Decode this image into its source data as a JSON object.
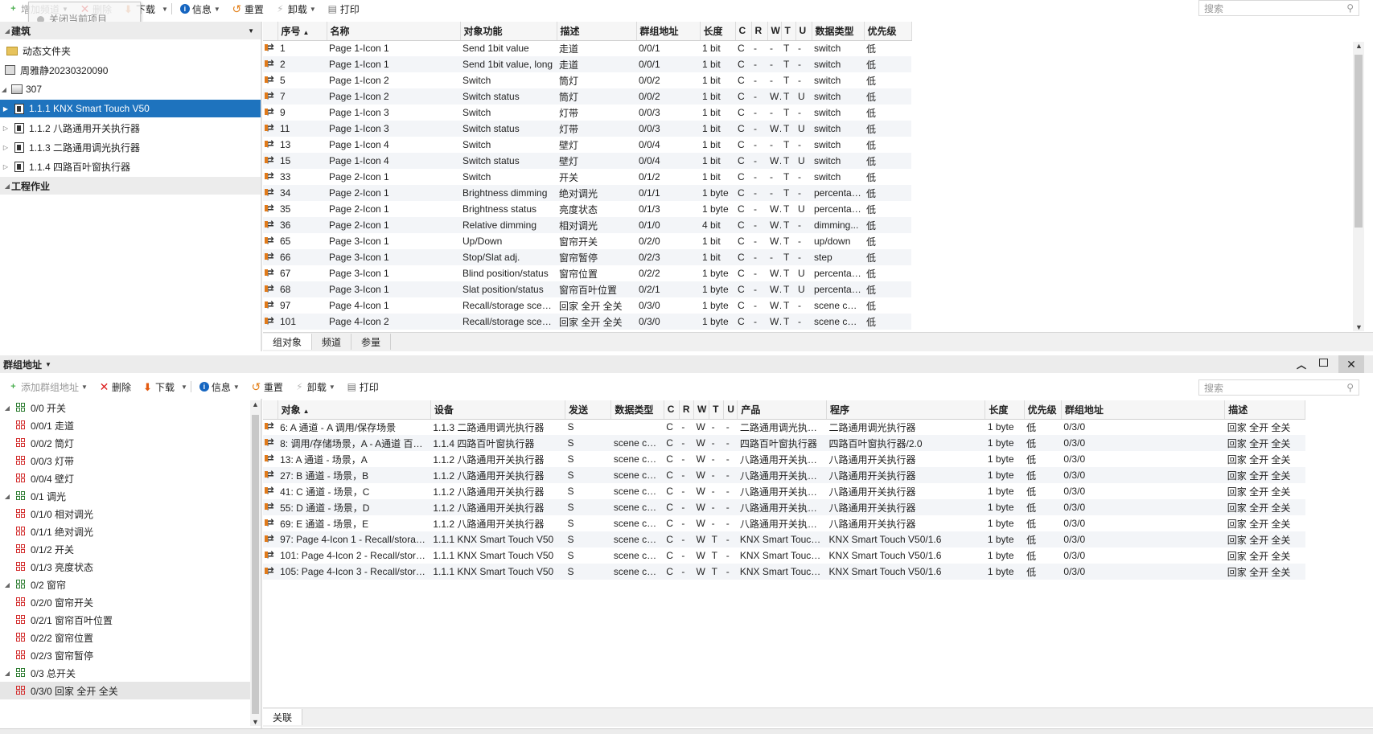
{
  "top_toolbar": {
    "add_label": "增加频道",
    "delete_label": "删除",
    "download_label": "下载",
    "info_label": "信息",
    "reset_label": "重置",
    "unload_label": "卸载",
    "print_label": "打印",
    "tooltip_text": "关闭当前项目",
    "search_placeholder": "搜索"
  },
  "building_panel": {
    "header": "建筑",
    "footer": "工程作业",
    "items": [
      {
        "label": "动态文件夹"
      },
      {
        "label": "周雅静20230320090"
      },
      {
        "label": "307"
      },
      {
        "label": "1.1.1 KNX Smart Touch V50"
      },
      {
        "label": "1.1.2 八路通用开关执行器"
      },
      {
        "label": "1.1.3 二路通用调光执行器"
      },
      {
        "label": "1.1.4 四路百叶窗执行器"
      }
    ]
  },
  "objects_table": {
    "columns": [
      "序号",
      "名称",
      "对象功能",
      "描述",
      "群组地址",
      "长度",
      "C",
      "R",
      "W",
      "T",
      "U",
      "数据类型",
      "优先级"
    ],
    "rows": [
      [
        "1",
        "Page 1-Icon 1",
        "Send 1bit value",
        "走道",
        "0/0/1",
        "1 bit",
        "C",
        "-",
        "-",
        "T",
        "-",
        "switch",
        "低"
      ],
      [
        "2",
        "Page 1-Icon 1",
        "Send 1bit value, long",
        "走道",
        "0/0/1",
        "1 bit",
        "C",
        "-",
        "-",
        "T",
        "-",
        "switch",
        "低"
      ],
      [
        "5",
        "Page 1-Icon 2",
        "Switch",
        "筒灯",
        "0/0/2",
        "1 bit",
        "C",
        "-",
        "-",
        "T",
        "-",
        "switch",
        "低"
      ],
      [
        "7",
        "Page 1-Icon 2",
        "Switch status",
        "筒灯",
        "0/0/2",
        "1 bit",
        "C",
        "-",
        "W",
        "T",
        "U",
        "switch",
        "低"
      ],
      [
        "9",
        "Page 1-Icon 3",
        "Switch",
        "灯带",
        "0/0/3",
        "1 bit",
        "C",
        "-",
        "-",
        "T",
        "-",
        "switch",
        "低"
      ],
      [
        "11",
        "Page 1-Icon 3",
        "Switch status",
        "灯带",
        "0/0/3",
        "1 bit",
        "C",
        "-",
        "W",
        "T",
        "U",
        "switch",
        "低"
      ],
      [
        "13",
        "Page 1-Icon 4",
        "Switch",
        "壁灯",
        "0/0/4",
        "1 bit",
        "C",
        "-",
        "-",
        "T",
        "-",
        "switch",
        "低"
      ],
      [
        "15",
        "Page 1-Icon 4",
        "Switch status",
        "壁灯",
        "0/0/4",
        "1 bit",
        "C",
        "-",
        "W",
        "T",
        "U",
        "switch",
        "低"
      ],
      [
        "33",
        "Page 2-Icon 1",
        "Switch",
        "开关",
        "0/1/2",
        "1 bit",
        "C",
        "-",
        "-",
        "T",
        "-",
        "switch",
        "低"
      ],
      [
        "34",
        "Page 2-Icon 1",
        "Brightness dimming",
        "绝对调光",
        "0/1/1",
        "1 byte",
        "C",
        "-",
        "-",
        "T",
        "-",
        "percentag...",
        "低"
      ],
      [
        "35",
        "Page 2-Icon 1",
        "Brightness status",
        "亮度状态",
        "0/1/3",
        "1 byte",
        "C",
        "-",
        "W",
        "T",
        "U",
        "percentag...",
        "低"
      ],
      [
        "36",
        "Page 2-Icon 1",
        "Relative dimming",
        "相对调光",
        "0/1/0",
        "4 bit",
        "C",
        "-",
        "W",
        "T",
        "-",
        "dimming...",
        "低"
      ],
      [
        "65",
        "Page 3-Icon 1",
        "Up/Down",
        "窗帘开关",
        "0/2/0",
        "1 bit",
        "C",
        "-",
        "W",
        "T",
        "-",
        "up/down",
        "低"
      ],
      [
        "66",
        "Page 3-Icon 1",
        "Stop/Slat adj.",
        "窗帘暂停",
        "0/2/3",
        "1 bit",
        "C",
        "-",
        "-",
        "T",
        "-",
        "step",
        "低"
      ],
      [
        "67",
        "Page 3-Icon 1",
        "Blind position/status",
        "窗帘位置",
        "0/2/2",
        "1 byte",
        "C",
        "-",
        "W",
        "T",
        "U",
        "percentag...",
        "低"
      ],
      [
        "68",
        "Page 3-Icon 1",
        "Slat position/status",
        "窗帘百叶位置",
        "0/2/1",
        "1 byte",
        "C",
        "-",
        "W",
        "T",
        "U",
        "percentag...",
        "低"
      ],
      [
        "97",
        "Page 4-Icon 1",
        "Recall/storage scene...",
        "回家 全开 全关",
        "0/3/0",
        "1 byte",
        "C",
        "-",
        "W",
        "T",
        "-",
        "scene con...",
        "低"
      ],
      [
        "101",
        "Page 4-Icon 2",
        "Recall/storage scene...",
        "回家 全开 全关",
        "0/3/0",
        "1 byte",
        "C",
        "-",
        "W",
        "T",
        "-",
        "scene con...",
        "低"
      ]
    ]
  },
  "objects_tabs": [
    "组对象",
    "频道",
    "参量"
  ],
  "group_panel": {
    "header": "群组地址",
    "toolbar": {
      "add_label": "添加群组地址",
      "delete_label": "删除",
      "download_label": "下载",
      "info_label": "信息",
      "reset_label": "重置",
      "unload_label": "卸载",
      "print_label": "打印",
      "search_placeholder": "搜索"
    },
    "tree": [
      {
        "label": "0/0 开关",
        "level": 0
      },
      {
        "label": "0/0/1 走道",
        "level": 1
      },
      {
        "label": "0/0/2 筒灯",
        "level": 1
      },
      {
        "label": "0/0/3 灯带",
        "level": 1
      },
      {
        "label": "0/0/4 壁灯",
        "level": 1
      },
      {
        "label": "0/1 调光",
        "level": 0
      },
      {
        "label": "0/1/0 相对调光",
        "level": 1
      },
      {
        "label": "0/1/1 绝对调光",
        "level": 1
      },
      {
        "label": "0/1/2 开关",
        "level": 1
      },
      {
        "label": "0/1/3 亮度状态",
        "level": 1
      },
      {
        "label": "0/2 窗帘",
        "level": 0
      },
      {
        "label": "0/2/0 窗帘开关",
        "level": 1
      },
      {
        "label": "0/2/1 窗帘百叶位置",
        "level": 1
      },
      {
        "label": "0/2/2 窗帘位置",
        "level": 1
      },
      {
        "label": "0/2/3 窗帘暂停",
        "level": 1
      },
      {
        "label": "0/3 总开关",
        "level": 0
      },
      {
        "label": "0/3/0 回家 全开 全关",
        "level": 1
      }
    ]
  },
  "links_table": {
    "columns": [
      "对象",
      "设备",
      "发送",
      "数据类型",
      "C",
      "R",
      "W",
      "T",
      "U",
      "产品",
      "程序",
      "长度",
      "优先级",
      "群组地址",
      "描述"
    ],
    "rows": [
      [
        "6: A 通道 - A 调用/保存场景",
        "1.1.3 二路通用调光执行器",
        "S",
        "",
        "C",
        "-",
        "W",
        "-",
        "-",
        "二路通用调光执行器",
        "二路通用调光执行器",
        "1 byte",
        "低",
        "0/3/0",
        "回家 全开 全关"
      ],
      [
        "8: 调用/存储场景，A - A通道 百叶...",
        "1.1.4 四路百叶窗执行器",
        "S",
        "scene con...",
        "C",
        "-",
        "W",
        "-",
        "-",
        "四路百叶窗执行器",
        "四路百叶窗执行器/2.0",
        "1 byte",
        "低",
        "0/3/0",
        "回家 全开 全关"
      ],
      [
        "13: A 通道 - 场景，A",
        "1.1.2 八路通用开关执行器",
        "S",
        "scene con...",
        "C",
        "-",
        "W",
        "-",
        "-",
        "八路通用开关执行器",
        "八路通用开关执行器",
        "1 byte",
        "低",
        "0/3/0",
        "回家 全开 全关"
      ],
      [
        "27: B 通道 - 场景，B",
        "1.1.2 八路通用开关执行器",
        "S",
        "scene con...",
        "C",
        "-",
        "W",
        "-",
        "-",
        "八路通用开关执行器",
        "八路通用开关执行器",
        "1 byte",
        "低",
        "0/3/0",
        "回家 全开 全关"
      ],
      [
        "41: C 通道 - 场景，C",
        "1.1.2 八路通用开关执行器",
        "S",
        "scene con...",
        "C",
        "-",
        "W",
        "-",
        "-",
        "八路通用开关执行器",
        "八路通用开关执行器",
        "1 byte",
        "低",
        "0/3/0",
        "回家 全开 全关"
      ],
      [
        "55: D 通道 - 场景，D",
        "1.1.2 八路通用开关执行器",
        "S",
        "scene con...",
        "C",
        "-",
        "W",
        "-",
        "-",
        "八路通用开关执行器",
        "八路通用开关执行器",
        "1 byte",
        "低",
        "0/3/0",
        "回家 全开 全关"
      ],
      [
        "69: E 通道 - 场景，E",
        "1.1.2 八路通用开关执行器",
        "S",
        "scene con...",
        "C",
        "-",
        "W",
        "-",
        "-",
        "八路通用开关执行器",
        "八路通用开关执行器",
        "1 byte",
        "低",
        "0/3/0",
        "回家 全开 全关"
      ],
      [
        "97: Page 4-Icon 1 - Recall/storage...",
        "1.1.1 KNX Smart Touch V50",
        "S",
        "scene con...",
        "C",
        "-",
        "W",
        "T",
        "-",
        "KNX Smart Touch...",
        "KNX Smart Touch V50/1.6",
        "1 byte",
        "低",
        "0/3/0",
        "回家 全开 全关"
      ],
      [
        "101: Page 4-Icon 2 - Recall/storag...",
        "1.1.1 KNX Smart Touch V50",
        "S",
        "scene con...",
        "C",
        "-",
        "W",
        "T",
        "-",
        "KNX Smart Touch...",
        "KNX Smart Touch V50/1.6",
        "1 byte",
        "低",
        "0/3/0",
        "回家 全开 全关"
      ],
      [
        "105: Page 4-Icon 3 - Recall/storag...",
        "1.1.1 KNX Smart Touch V50",
        "S",
        "scene con...",
        "C",
        "-",
        "W",
        "T",
        "-",
        "KNX Smart Touch...",
        "KNX Smart Touch V50/1.6",
        "1 byte",
        "低",
        "0/3/0",
        "回家 全开 全关"
      ]
    ]
  },
  "links_tabs": [
    "关联"
  ]
}
